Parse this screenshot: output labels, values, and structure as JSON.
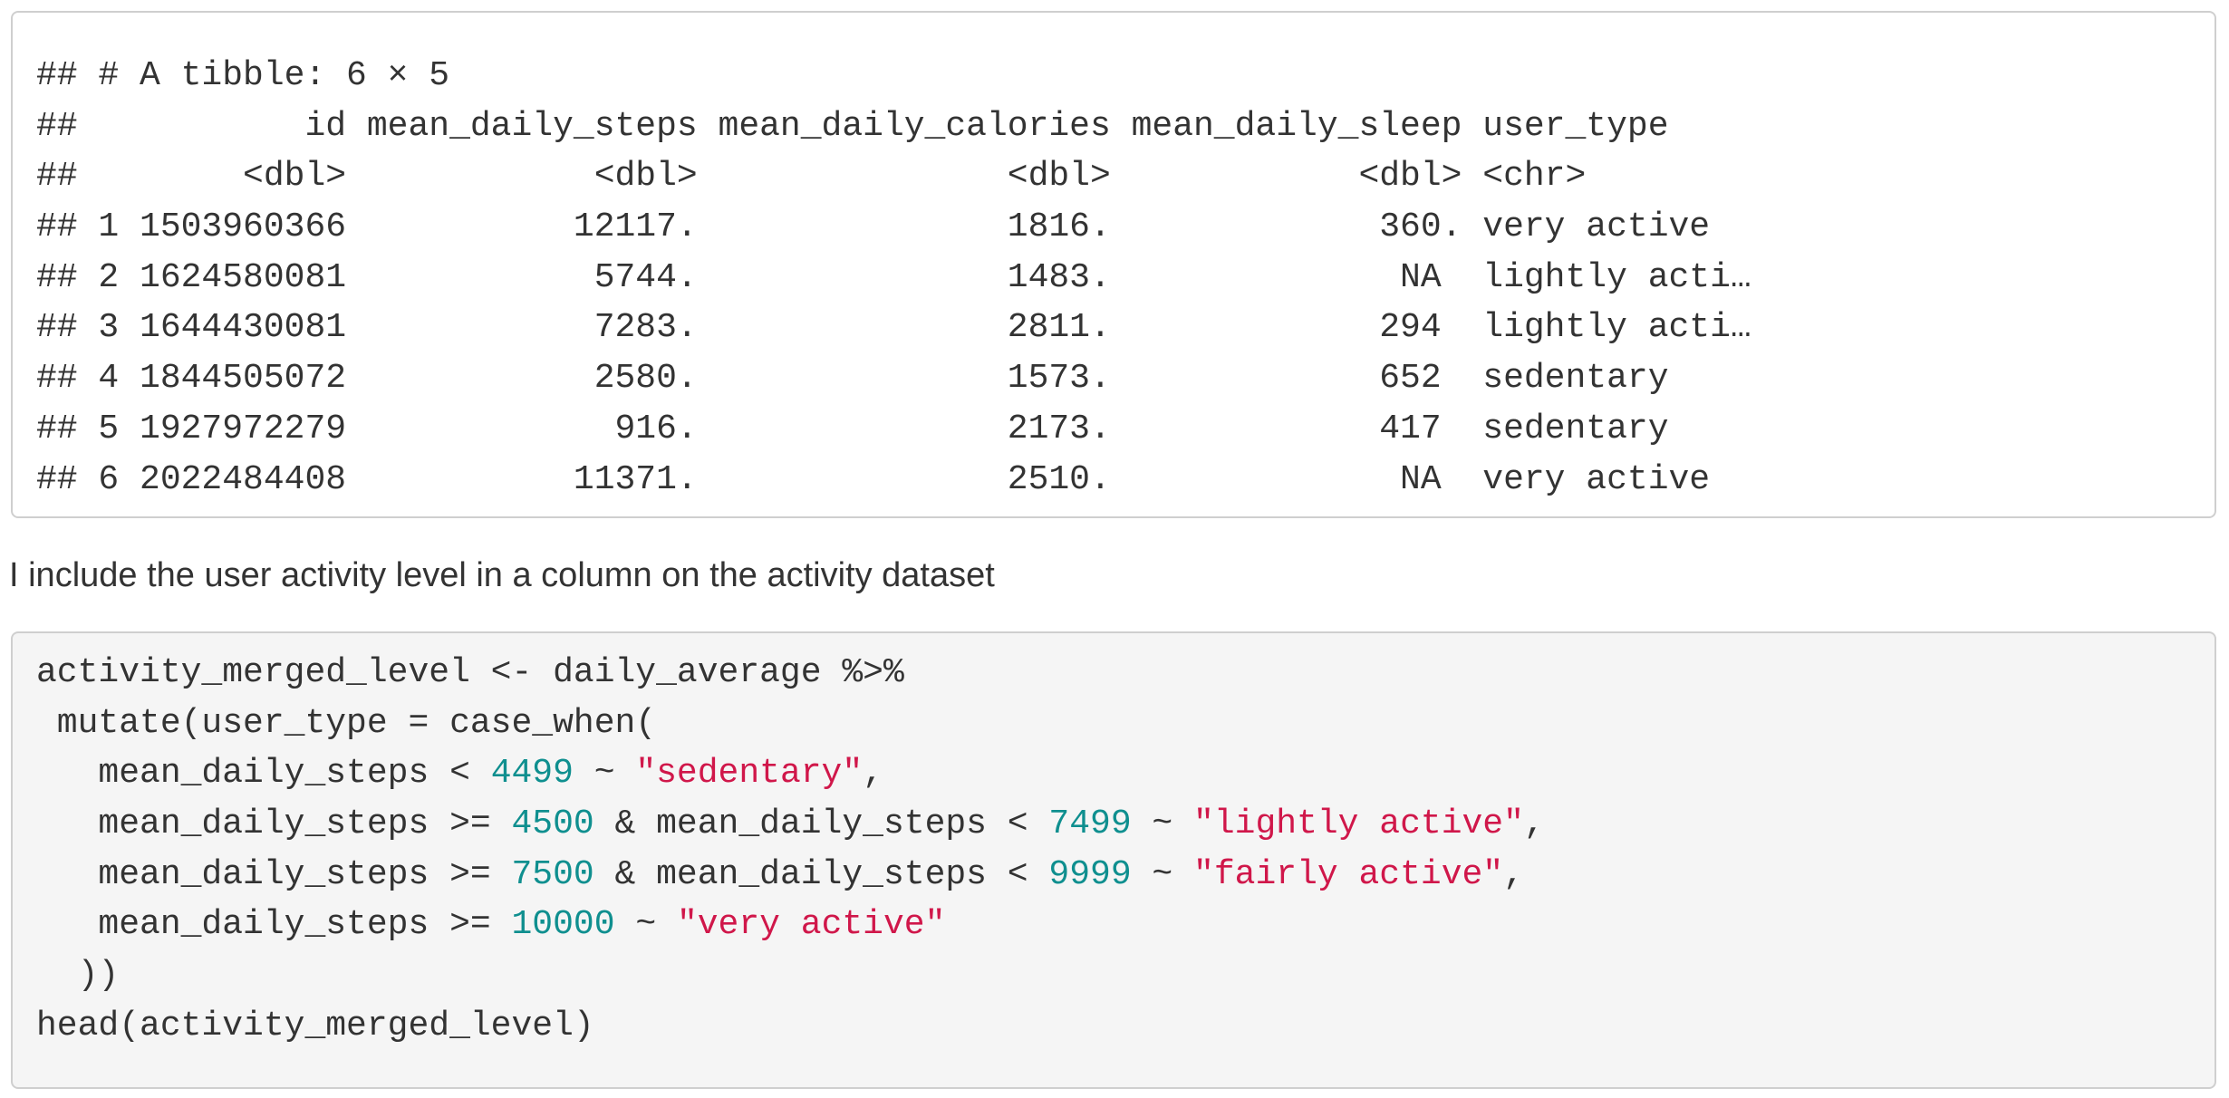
{
  "output": {
    "lines": [
      "## # A tibble: 6 × 5",
      "##           id mean_daily_steps mean_daily_calories mean_daily_sleep user_type",
      "##        <dbl>            <dbl>               <dbl>            <dbl> <chr>",
      "## 1 1503960366           12117.               1816.             360. very active",
      "## 2 1624580081            5744.               1483.              NA  lightly acti…",
      "## 3 1644430081            7283.               2811.             294  lightly acti…",
      "## 4 1844505072            2580.               1573.             652  sedentary",
      "## 5 1927972279             916.               2173.             417  sedentary",
      "## 6 2022484408           11371.               2510.              NA  very active"
    ]
  },
  "prose": {
    "text": "I include the user activity level in a column on the activity dataset"
  },
  "code": {
    "line1": "activity_merged_level <- daily_average %>%",
    "line2": " mutate(user_type = case_when(",
    "line3": {
      "a": "   mean_daily_steps < ",
      "n1": "4499",
      "b": " ~ ",
      "s1": "\"sedentary\"",
      "c": ","
    },
    "line4": {
      "a": "   mean_daily_steps >= ",
      "n1": "4500",
      "b": " & mean_daily_steps < ",
      "n2": "7499",
      "c": " ~ ",
      "s1": "\"lightly active\"",
      "d": ","
    },
    "line5": {
      "a": "   mean_daily_steps >= ",
      "n1": "7500",
      "b": " & mean_daily_steps < ",
      "n2": "9999",
      "c": " ~ ",
      "s1": "\"fairly active\"",
      "d": ","
    },
    "line6": {
      "a": "   mean_daily_steps >= ",
      "n1": "10000",
      "b": " ~ ",
      "s1": "\"very active\""
    },
    "line7": "  ))",
    "line8": "head(activity_merged_level)"
  },
  "colors": {
    "number": "#0f8f8f",
    "string": "#d0174a",
    "text": "#333333",
    "code_bg": "#f5f5f5",
    "border": "#cfcfcf"
  }
}
